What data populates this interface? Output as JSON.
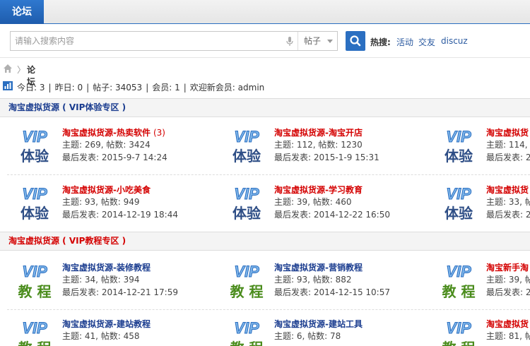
{
  "header": {
    "brand": "论坛"
  },
  "search": {
    "placeholder": "请输入搜索内容",
    "type_label": "帖子",
    "hot_label": "热搜:",
    "hot_links": [
      "活动",
      "交友",
      "discuz"
    ]
  },
  "breadcrumb": {
    "separator": "〉",
    "label": "论坛"
  },
  "stats": {
    "today_label": "今日:",
    "today": "3",
    "yesterday_label": "昨日:",
    "yesterday": "0",
    "posts_label": "帖子:",
    "posts": "34053",
    "members_label": "会员:",
    "members": "1",
    "welcome_label": "欢迎新会员:",
    "newest_member": "admin"
  },
  "sections": [
    {
      "title": "淘宝虚拟货源 ( VIP体验专区 )",
      "badge_top": "VIP",
      "badge_bottom": "体验",
      "forums": [
        {
          "title": "淘宝虚拟货源-热卖软件",
          "new_count": "(3)",
          "meta": "主题: 269, 帖数: 3424",
          "last": "最后发表: 2015-9-7 14:24"
        },
        {
          "title": "淘宝虚拟货源-淘宝开店",
          "new_count": "",
          "meta": "主题: 112, 帖数: 1230",
          "last": "最后发表: 2015-1-9 15:31"
        },
        {
          "title": "淘宝虚拟货",
          "new_count": "",
          "meta": "主题: 114, 帖",
          "last": "最后发表: 2"
        },
        {
          "title": "淘宝虚拟货源-小吃美食",
          "new_count": "",
          "meta": "主题: 93, 帖数: 949",
          "last": "最后发表: 2014-12-19 18:44"
        },
        {
          "title": "淘宝虚拟货源-学习教育",
          "new_count": "",
          "meta": "主题: 39, 帖数: 460",
          "last": "最后发表: 2014-12-22 16:50"
        },
        {
          "title": "淘宝虚拟货",
          "new_count": "",
          "meta": "主题: 33, 帖",
          "last": "最后发表: 2"
        }
      ]
    },
    {
      "title": "淘宝虚拟货源 ( VIP教程专区 )",
      "badge_top": "VIP",
      "badge_bottom": "教 程",
      "forums": [
        {
          "title": "淘宝虚拟货源-装修教程",
          "new_count": "",
          "meta": "主题: 34, 帖数: 394",
          "last": "最后发表: 2014-12-21 17:59"
        },
        {
          "title": "淘宝虚拟货源-营销教程",
          "new_count": "",
          "meta": "主题: 93, 帖数: 882",
          "last": "最后发表: 2014-12-15 10:57"
        },
        {
          "title": "淘宝新手淘",
          "new_count": "",
          "meta": "主题: 39, 帖",
          "last": "最后发表: 2"
        },
        {
          "title": "淘宝虚拟货源-建站教程",
          "new_count": "",
          "meta": "主题: 41, 帖数: 458",
          "last": ""
        },
        {
          "title": "淘宝虚拟货源-建站工具",
          "new_count": "",
          "meta": "主题: 6, 帖数: 78",
          "last": ""
        },
        {
          "title": "淘宝虚拟货",
          "new_count": "",
          "meta": "主题: 81, 帖",
          "last": ""
        }
      ]
    }
  ],
  "colors": {
    "brand_blue": "#2b6fc1",
    "title_red": "#d40000",
    "title_blue": "#1a3c8f",
    "badge_green": "#4a8c1c"
  }
}
